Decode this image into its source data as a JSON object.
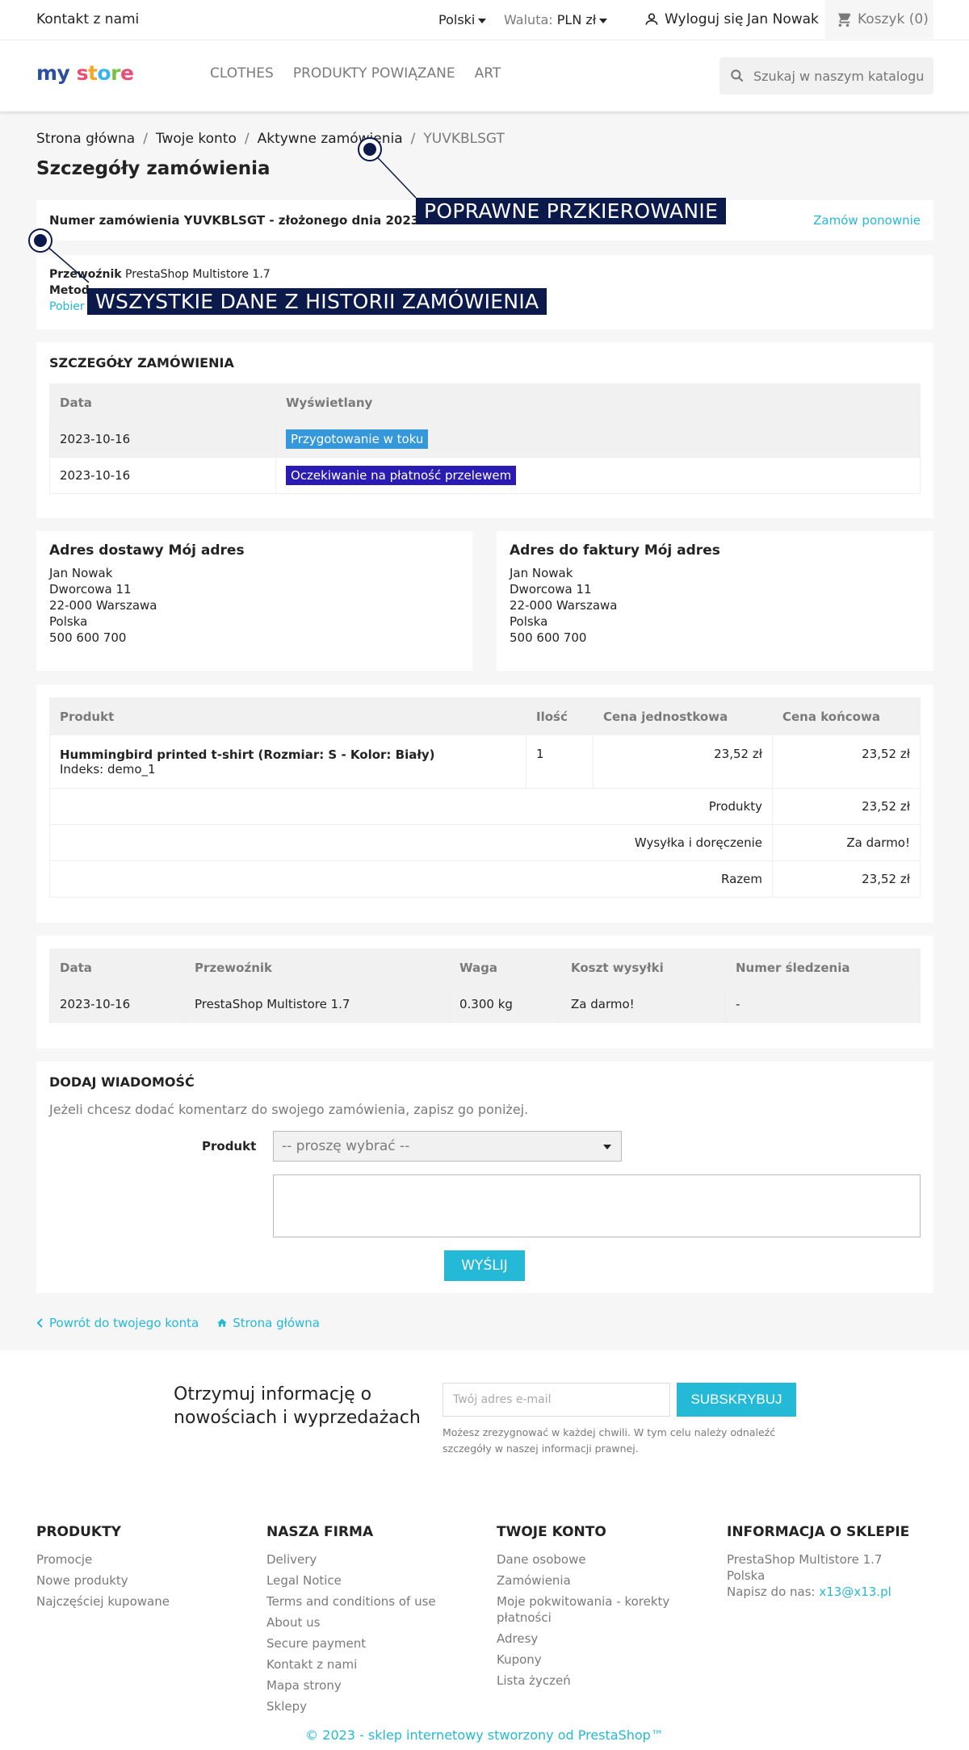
{
  "topnav": {
    "contact": "Kontakt z nami",
    "language": "Polski",
    "currency_label": "Waluta:",
    "currency_value": "PLN zł",
    "logout": "Wyloguj się",
    "user": "Jan Nowak",
    "cart": "Koszyk (0)"
  },
  "header": {
    "logo": "my store",
    "menu": [
      "CLOTHES",
      "PRODUKTY POWIĄZANE",
      "ART"
    ],
    "search_placeholder": "Szukaj w naszym katalogu"
  },
  "breadcrumb": [
    "Strona główna",
    "Twoje konto",
    "Aktywne zamówienia",
    "YUVKBLSGT"
  ],
  "page_title": "Szczegóły zamówienia",
  "order": {
    "number_line": "Numer zamówienia YUVKBLSGT - złożonego dnia 2023-10-16",
    "reorder": "Zamów ponownie",
    "carrier_label": "Przewoźnik",
    "carrier_value": "PrestaShop Multistore 1.7",
    "payment_label": "Metod",
    "invoice_link": "Pobier"
  },
  "annotations": {
    "redirect": "POPRAWNE PRZKIEROWANIE",
    "history": "WSZYSTKIE DANE Z HISTORII ZAMÓWIENIA"
  },
  "status": {
    "title": "SZCZEGÓŁY ZAMÓWIENIA",
    "headers": [
      "Data",
      "Wyświetlany"
    ],
    "rows": [
      {
        "date": "2023-10-16",
        "label": "Przygotowanie w toku",
        "color": "#3498db"
      },
      {
        "date": "2023-10-16",
        "label": "Oczekiwanie na płatność przelewem",
        "color": "#4169e1"
      }
    ]
  },
  "addresses": {
    "delivery_title": "Adres dostawy Mój adres",
    "invoice_title": "Adres do faktury Mój adres",
    "lines": [
      "Jan Nowak",
      "Dworcowa 11",
      "22-000 Warszawa",
      "Polska",
      "500 600 700"
    ]
  },
  "products": {
    "headers": [
      "Produkt",
      "Ilość",
      "Cena jednostkowa",
      "Cena końcowa"
    ],
    "items": [
      {
        "name": "Hummingbird printed t-shirt (Rozmiar: S - Kolor: Biały)",
        "ref": "Indeks: demo_1",
        "qty": "1",
        "unit": "23,52 zł",
        "total": "23,52 zł"
      }
    ],
    "summary": [
      {
        "label": "Produkty",
        "value": "23,52 zł"
      },
      {
        "label": "Wysyłka i doręczenie",
        "value": "Za darmo!"
      },
      {
        "label": "Razem",
        "value": "23,52 zł"
      }
    ]
  },
  "shipping": {
    "headers": [
      "Data",
      "Przewoźnik",
      "Waga",
      "Koszt wysyłki",
      "Numer śledzenia"
    ],
    "row": [
      "2023-10-16",
      "PrestaShop Multistore 1.7",
      "0.300 kg",
      "Za darmo!",
      "-"
    ]
  },
  "message": {
    "title": "DODAJ WIADOMOŚĆ",
    "intro": "Jeżeli chcesz dodać komentarz do swojego zamówienia, zapisz go poniżej.",
    "product_label": "Produkt",
    "select_value": "-- proszę wybrać --",
    "send": "WYŚLIJ"
  },
  "links": {
    "back": "Powrót do twojego konta",
    "home": "Strona główna"
  },
  "newsletter": {
    "title_1": "Otrzymuj informację o",
    "title_2": "nowościach i wyprzedażach",
    "placeholder": "Twój adres e-mail",
    "button": "SUBSKRYBUJ",
    "note": "Możesz zrezygnować w każdej chwili. W tym celu należy odnaleźć szczegóły w naszej informacji prawnej."
  },
  "footer": {
    "col1_title": "PRODUKTY",
    "col1": [
      "Promocje",
      "Nowe produkty",
      "Najczęściej kupowane"
    ],
    "col2_title": "NASZA FIRMA",
    "col2": [
      "Delivery",
      "Legal Notice",
      "Terms and conditions of use",
      "About us",
      "Secure payment",
      "Kontakt z nami",
      "Mapa strony",
      "Sklepy"
    ],
    "col3_title": "TWOJE KONTO",
    "col3": [
      "Dane osobowe",
      "Zamówienia",
      "Moje pokwitowania - korekty płatności",
      "Adresy",
      "Kupony",
      "Lista życzeń"
    ],
    "col4_title": "INFORMACJA O SKLEPIE",
    "store_name": "PrestaShop Multistore 1.7",
    "country": "Polska",
    "mail_label": "Napisz do nas:",
    "mail": "x13@x13.pl",
    "copyright": "© 2023 - sklep internetowy stworzony od PrestaShop™"
  },
  "colors": {
    "accent": "#24b9d7",
    "annotation": "#0b1a4a"
  }
}
